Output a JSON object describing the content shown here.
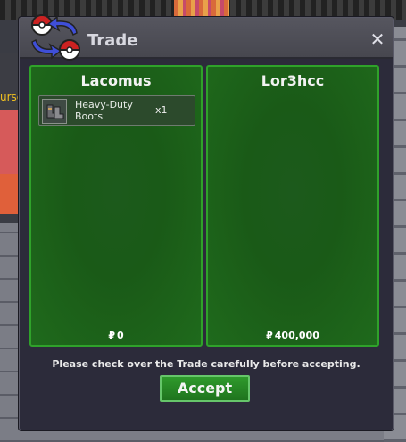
{
  "window": {
    "title": "Trade"
  },
  "left_panel": {
    "player": "Lacomus",
    "items": [
      {
        "name": "Heavy-Duty Boots",
        "qty": "x1"
      }
    ],
    "money": "0"
  },
  "right_panel": {
    "player": "Lor3hcc",
    "items": [],
    "money": "400,000"
  },
  "currency_symbol": "₽",
  "note": "Please check over the Trade carefully before accepting.",
  "accept_label": "Accept",
  "background_text": "urse",
  "colors": {
    "panel_bg": "#1a5a17",
    "panel_border": "#2fa22a",
    "accent": "#2f9a2c"
  }
}
